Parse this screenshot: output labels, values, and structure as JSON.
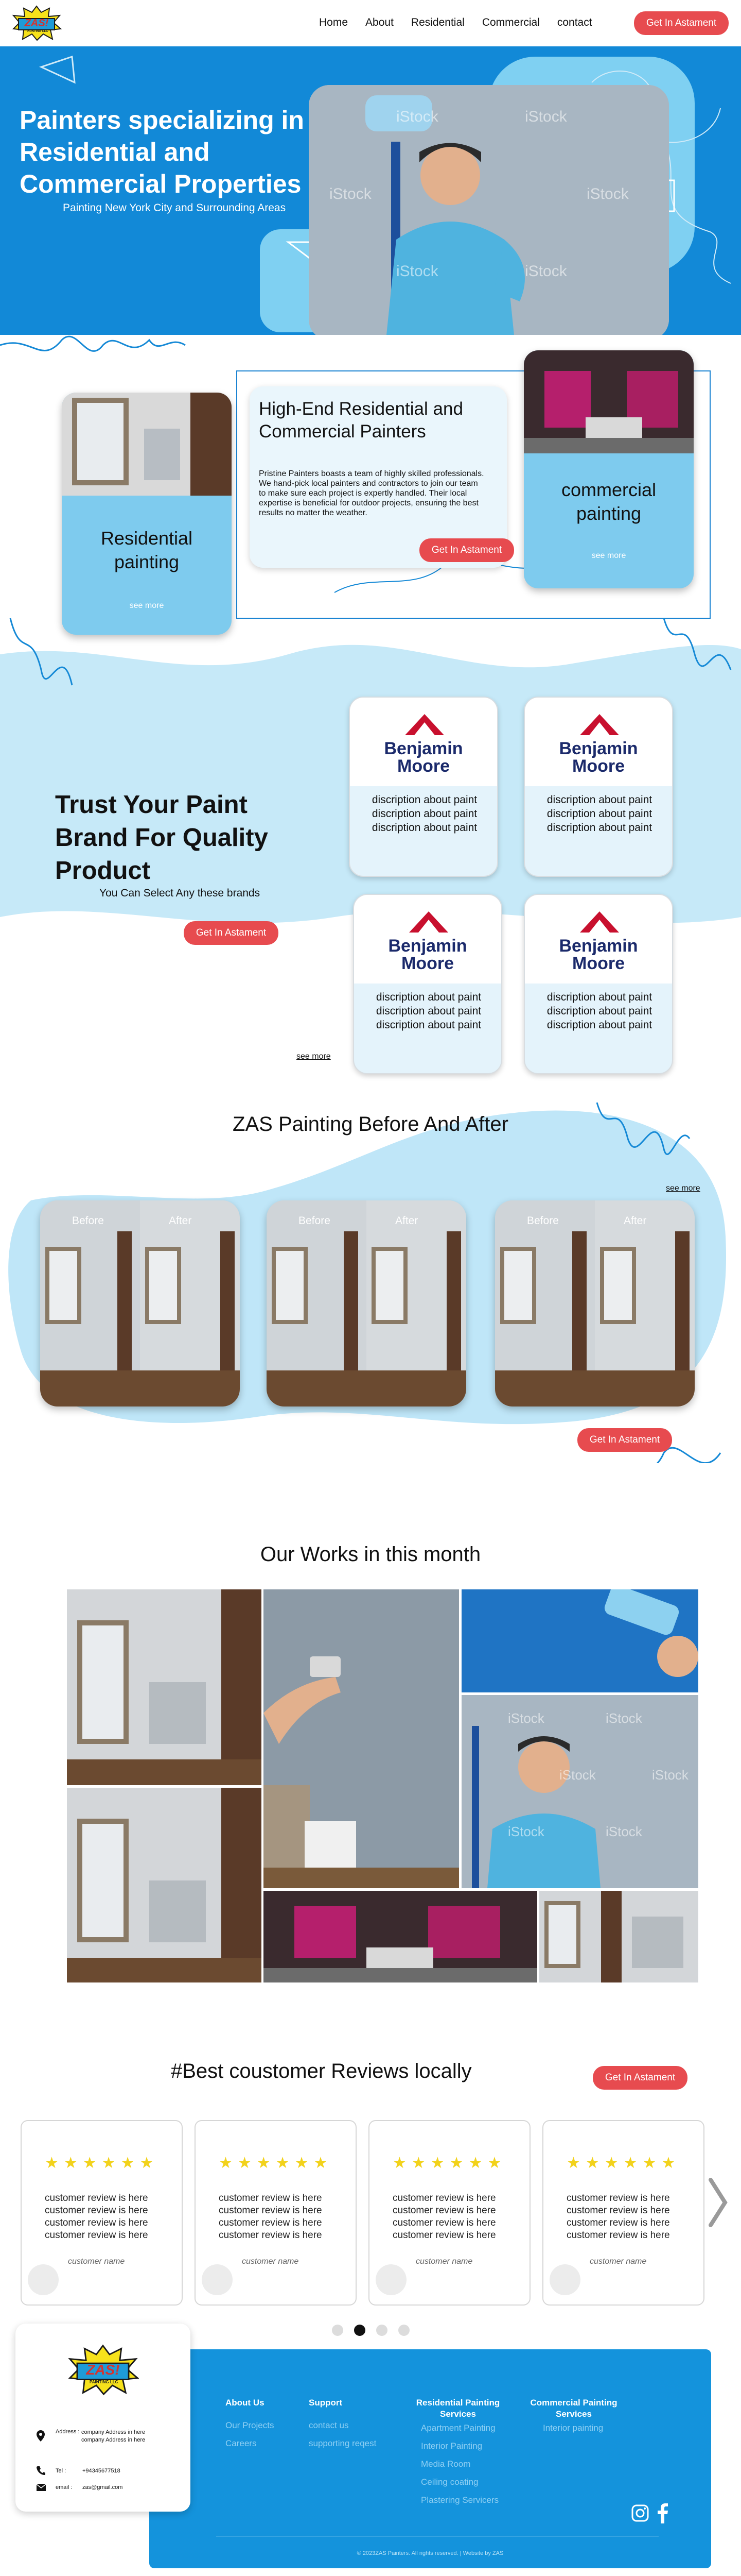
{
  "header": {
    "logo_text": "ZAS!",
    "logo_sub": "PAINTING LLC",
    "nav": [
      "Home",
      "About",
      "Residential",
      "Commercial",
      "contact"
    ],
    "cta": "Get In Astament"
  },
  "hero": {
    "title": "Painters specializing in Residential and Commercial Properties",
    "subtitle": "Painting New York City and Surrounding Areas",
    "watermark": "iStock"
  },
  "services": {
    "residential_label": "Residential painting",
    "residential_more": "see more",
    "commercial_label": "commercial painting",
    "commercial_more": "see more",
    "info_title": "High-End Residential and Commercial Painters",
    "info_body": "Pristine Painters boasts a team of highly skilled professionals. We hand-pick local painters and contractors to join our team to make sure each project is expertly handled. Their local expertise is beneficial for outdoor projects, ensuring the best results no matter the weather.",
    "info_cta": "Get In Astament"
  },
  "brands": {
    "title": "Trust Your Paint Brand For Quality Product",
    "subtitle": "You Can Select Any these brands",
    "cta": "Get In Astament",
    "see_more": "see more",
    "cards": [
      {
        "brand_line1": "Benjamin",
        "brand_line2": "Moore",
        "text": "discription about paint discription about paint discription about paint"
      },
      {
        "brand_line1": "Benjamin",
        "brand_line2": "Moore",
        "text": "discription about paint discription about paint discription about paint"
      },
      {
        "brand_line1": "Benjamin",
        "brand_line2": "Moore",
        "text": "discription about paint discription about paint discription about paint"
      },
      {
        "brand_line1": "Benjamin",
        "brand_line2": "Moore",
        "text": "discription about paint discription about paint discription about paint"
      }
    ],
    "brand_color": "#c8102e",
    "brand_text_color": "#1b2a6b"
  },
  "before_after": {
    "title": "ZAS Painting Before And After",
    "see_more": "see more",
    "before_label": "Before",
    "after_label": "After",
    "cta": "Get In Astament"
  },
  "works": {
    "title": "Our Works in this month",
    "watermark": "iStock"
  },
  "reviews": {
    "title": "#Best coustomer Reviews locally",
    "cta": "Get In Astament",
    "stars": "★★★★★★",
    "cards": [
      {
        "lines": [
          "customer review is here",
          "customer review is here",
          "customer review is here",
          "customer review is here"
        ],
        "name": "customer name"
      },
      {
        "lines": [
          "customer review is here",
          "customer review is here",
          "customer review is here",
          "customer review is here"
        ],
        "name": "customer name"
      },
      {
        "lines": [
          "customer review is here",
          "customer review is here",
          "customer review is here",
          "customer review is here"
        ],
        "name": "customer name"
      },
      {
        "lines": [
          "customer review is here",
          "customer review is here",
          "customer review is here",
          "customer review is here"
        ],
        "name": "customer name"
      }
    ],
    "active_dot": 1
  },
  "footer": {
    "address_label": "Address :",
    "address_value": "company Address in here company Address in here",
    "tel_label": "Tel :",
    "tel_value": "+94345677518",
    "email_label": "email :",
    "email_value": "zas@gmail.com",
    "col1": {
      "heading": "About Us",
      "links": [
        "Our Projects",
        "Careers"
      ]
    },
    "col2": {
      "heading": "Support",
      "links": [
        "contact us",
        "supporting reqest"
      ]
    },
    "col3": {
      "heading": "Residential Painting Services",
      "links": [
        "Apartment Painting",
        "Interior Painting",
        "Media Room",
        "Ceiling coating",
        "Plastering Servicers"
      ]
    },
    "col4": {
      "heading": "Commercial Painting Services",
      "links": [
        "Interior painting"
      ]
    },
    "copyright": "© 2023ZAS Painters. All rights reserved. | Website by ZAS"
  }
}
